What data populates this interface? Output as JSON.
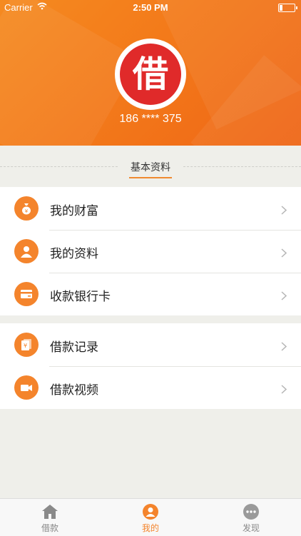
{
  "status_bar": {
    "carrier": "Carrier",
    "time": "2:50 PM"
  },
  "profile": {
    "logo_char": "借",
    "phone": "186 **** 375"
  },
  "section": {
    "title": "基本资料"
  },
  "group1": [
    {
      "label": "我的财富",
      "icon": "money-bag-icon"
    },
    {
      "label": "我的资料",
      "icon": "user-icon"
    },
    {
      "label": "收款银行卡",
      "icon": "bank-card-icon"
    }
  ],
  "group2": [
    {
      "label": "借款记录",
      "icon": "records-icon"
    },
    {
      "label": "借款视频",
      "icon": "video-icon"
    }
  ],
  "tabbar": [
    {
      "label": "借款",
      "icon": "home-icon",
      "active": false
    },
    {
      "label": "我的",
      "icon": "profile-icon",
      "active": true
    },
    {
      "label": "发现",
      "icon": "more-icon",
      "active": false
    }
  ],
  "colors": {
    "accent": "#f4842c",
    "logo_red": "#e02a2a",
    "header": "#f37a1a"
  }
}
